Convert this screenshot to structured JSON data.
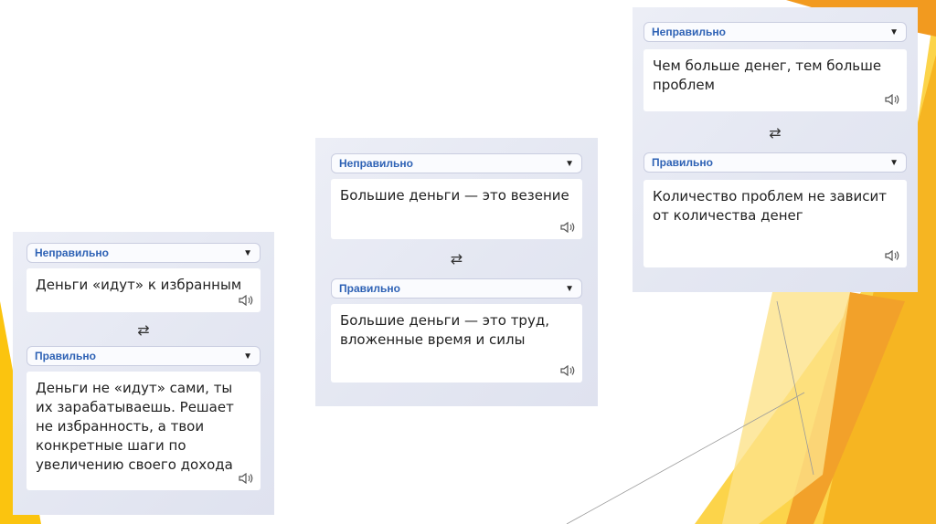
{
  "cards": [
    {
      "wrong_label": "Неправильно",
      "wrong_text": "Деньги «идут» к избранным",
      "swap_icon": "⇄",
      "right_label": "Правильно",
      "right_text": "Деньги не «идут» сами, ты их зарабатываешь. Решает не избранность, а твои конкретные шаги по увеличению своего дохода"
    },
    {
      "wrong_label": "Неправильно",
      "wrong_text": "Большие деньги — это везение",
      "swap_icon": "⇄",
      "right_label": "Правильно",
      "right_text": "Большие деньги — это труд, вложенные время и силы"
    },
    {
      "wrong_label": "Неправильно",
      "wrong_text": "Чем больше денег, тем больше проблем",
      "swap_icon": "⇄",
      "right_label": "Правильно",
      "right_text": "Количество проблем не зависит от количества денег"
    }
  ],
  "icons": {
    "dropdown": "chevron-down-icon",
    "speaker": "speaker-icon",
    "swap": "swap-icon"
  },
  "colors": {
    "label_blue": "#2e62b5",
    "accent_orange": "#f29a1f",
    "accent_yellow": "#fbc40f"
  }
}
